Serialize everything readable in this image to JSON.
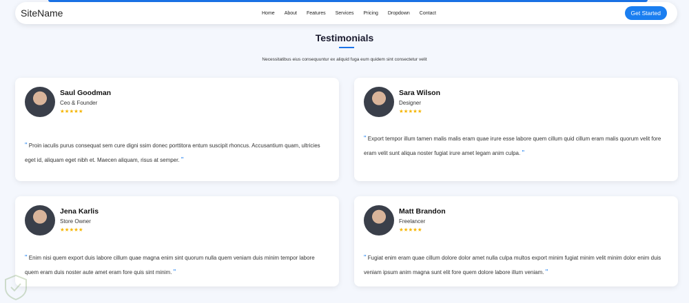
{
  "header": {
    "logo": "SiteName",
    "menu": [
      "Home",
      "About",
      "Features",
      "Services",
      "Pricing",
      "Dropdown",
      "Contact"
    ],
    "cta": "Get Started"
  },
  "section": {
    "title": "Testimonials",
    "subtitle": "Necessitatibus eius consequuntur ex aliquid fuga eum quidem sint consectetur velit"
  },
  "testimonials": [
    {
      "name": "Saul Goodman",
      "role": "Ceo & Founder",
      "stars": "★★★★★",
      "rating": 5,
      "quote": "Proin iaculis purus consequat sem cure digni ssim donec porttitora entum suscipit rhoncus. Accusantium quam, ultricies eget id, aliquam eget nibh et. Maecen aliquam, risus at semper."
    },
    {
      "name": "Sara Wilson",
      "role": "Designer",
      "stars": "★★★★★",
      "rating": 5,
      "quote": "Export tempor illum tamen malis malis eram quae irure esse labore quem cillum quid cillum eram malis quorum velit fore eram velit sunt aliqua noster fugiat irure amet legam anim culpa."
    },
    {
      "name": "Jena Karlis",
      "role": "Store Owner",
      "stars": "★★★★★",
      "rating": 5,
      "quote": "Enim nisi quem export duis labore cillum quae magna enim sint quorum nulla quem veniam duis minim tempor labore quem eram duis noster aute amet eram fore quis sint minim."
    },
    {
      "name": "Matt Brandon",
      "role": "Freelancer",
      "stars": "★★★★★",
      "rating": 5,
      "quote": "Fugiat enim eram quae cillum dolore dolor amet nulla culpa multos export minim fugiat minim velit minim dolor enim duis veniam ipsum anim magna sunt elit fore quem dolore labore illum veniam."
    }
  ],
  "quote_mark": "\""
}
